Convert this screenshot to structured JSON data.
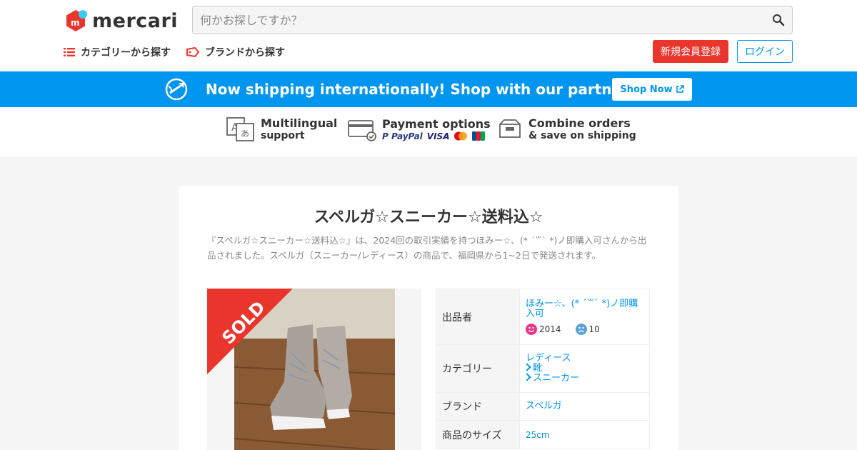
{
  "header": {
    "logo_text": "mercari",
    "search_placeholder": "何かお探しですか？",
    "nav": {
      "category_label": "カテゴリーから探す",
      "brand_label": "ブランドから探す"
    },
    "signup_label": "新規会員登録",
    "login_label": "ログイン"
  },
  "banner": {
    "text": "Now shipping internationally! Shop with our partner Buyee!",
    "button_label": "Shop Now"
  },
  "features": [
    {
      "title": "Multilingual",
      "subtitle": "support",
      "icon": "translate-icon"
    },
    {
      "title": "Payment options",
      "subtitle": "PayPal VISA",
      "icon": "card-icon"
    },
    {
      "title": "Combine orders",
      "subtitle": "& save on shipping",
      "icon": "box-icon"
    }
  ],
  "item": {
    "title": "スペルガ☆スニーカー☆送料込☆",
    "description": "『スペルガ☆スニーカー☆送料込☆』は、2024回の取引実績を持つほみー☆、(* ´꒳` *)ノ即購入可さんから出品されました。スペルガ（スニーカー/レディース）の商品で、福岡県から1~2日で発送されます。",
    "sold_label": "SOLD",
    "details": {
      "seller_label": "出品者",
      "seller_name": "ほみー☆、(* ´꒳` *)ノ即購入可",
      "rating_good": "2014",
      "rating_bad": "10",
      "category_label": "カテゴリー",
      "category_1": "レディース",
      "category_2": "靴",
      "category_3": "スニーカー",
      "brand_label": "ブランド",
      "brand_value": "スペルガ",
      "size_label": "商品のサイズ",
      "size_value": "25cm"
    }
  },
  "colors": {
    "brand_red": "#ea352d",
    "accent_blue": "#0095ee"
  }
}
